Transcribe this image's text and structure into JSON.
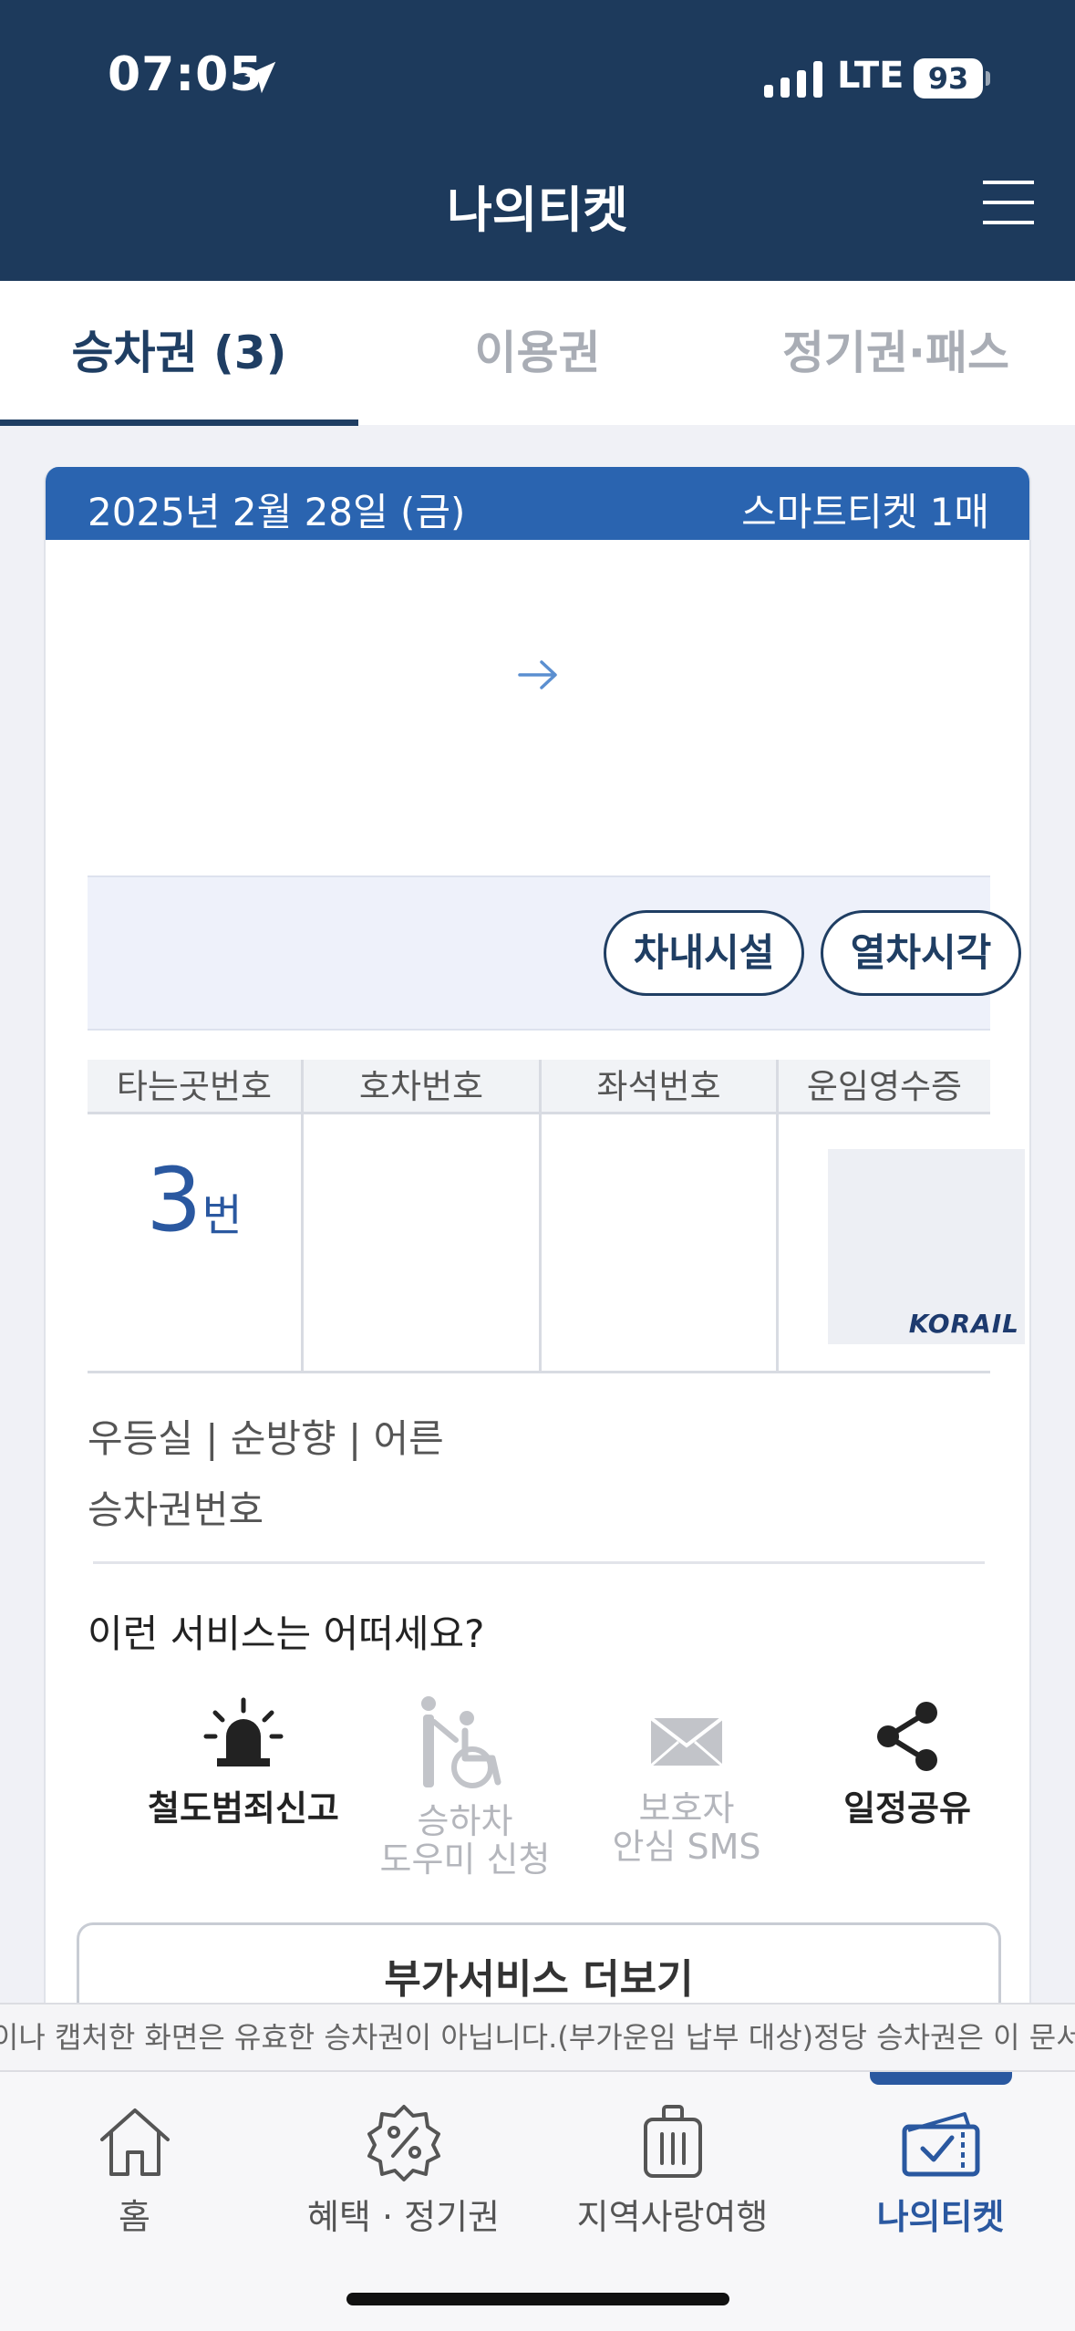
{
  "status_bar": {
    "time": "07:05",
    "network": "LTE",
    "battery": "93"
  },
  "header": {
    "title": "나의티켓"
  },
  "tabs": [
    {
      "label": "승차권 (3)",
      "active": true
    },
    {
      "label": "이용권",
      "active": false
    },
    {
      "label": "정기권·패스",
      "active": false
    }
  ],
  "ticket": {
    "date": "2025년 2월 28일 (금)",
    "ticket_count": "스마트티켓 1매",
    "buttons": {
      "facilities": "차내시설",
      "timetable": "열차시각"
    },
    "table": {
      "headers": [
        "타는곳번호",
        "호차번호",
        "좌석번호",
        "운임영수증"
      ],
      "platform_number": "3",
      "platform_unit": "번",
      "receipt_logo": "KORAIL"
    },
    "seat_info": "우등실 | 순방향 | 어른",
    "ticket_number_label": "승차권번호"
  },
  "services": {
    "title": "이런 서비스는 어떠세요?",
    "items": [
      {
        "label": "철도범죄신고",
        "icon": "siren-icon",
        "enabled": true
      },
      {
        "label_line1": "승하차",
        "label_line2": "도우미 신청",
        "icon": "wheelchair-icon",
        "enabled": false
      },
      {
        "label_line1": "보호자",
        "label_line2": "안심 SMS",
        "icon": "envelope-icon",
        "enabled": false
      },
      {
        "label": "일정공유",
        "icon": "share-icon",
        "enabled": true
      }
    ],
    "more_button": "부가서비스 더보기"
  },
  "notice": "l이나 캡처한 화면은 유효한 승차권이 아닙니다.(부가운임 납부 대상)정당 승차권은 이 문서",
  "bottom_nav": [
    {
      "label": "홈",
      "icon": "home-icon",
      "active": false
    },
    {
      "label": "혜택 · 정기권",
      "icon": "discount-badge-icon",
      "active": false
    },
    {
      "label": "지역사랑여행",
      "icon": "luggage-icon",
      "active": false
    },
    {
      "label": "나의티켓",
      "icon": "ticket-check-icon",
      "active": true
    }
  ],
  "colors": {
    "header_bg": "#1d3a5c",
    "accent": "#2a64b0",
    "active_text": "#1f3e63"
  }
}
